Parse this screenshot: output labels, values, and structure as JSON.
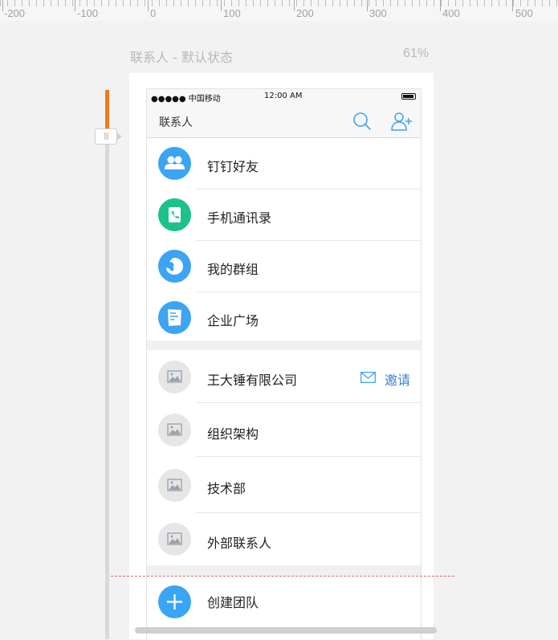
{
  "ruler": {
    "labels": [
      "-200",
      "-100",
      "0",
      "100",
      "200",
      "300",
      "400",
      "500"
    ]
  },
  "artboard": {
    "title": "联系人 - 默认状态",
    "zoom": "61%"
  },
  "statusbar": {
    "carrier": "●●●●● 中国移动",
    "time": "12:00 AM"
  },
  "navbar": {
    "title": "联系人"
  },
  "section1": [
    {
      "label": "钉钉好友",
      "icon": "friends-icon",
      "color": "#3ba4f3"
    },
    {
      "label": "手机通讯录",
      "icon": "phone-contacts-icon",
      "color": "#1dc18a"
    },
    {
      "label": "我的群组",
      "icon": "group-chat-icon",
      "color": "#3ba4f3"
    },
    {
      "label": "企业广场",
      "icon": "enterprise-doc-icon",
      "color": "#3ba4f3"
    }
  ],
  "section2": {
    "company": {
      "label": "王大锤有限公司",
      "invite": "邀请"
    },
    "items": [
      {
        "label": "组织架构"
      },
      {
        "label": "技术部"
      },
      {
        "label": "外部联系人"
      }
    ]
  },
  "section3": {
    "create": "创建团队"
  }
}
